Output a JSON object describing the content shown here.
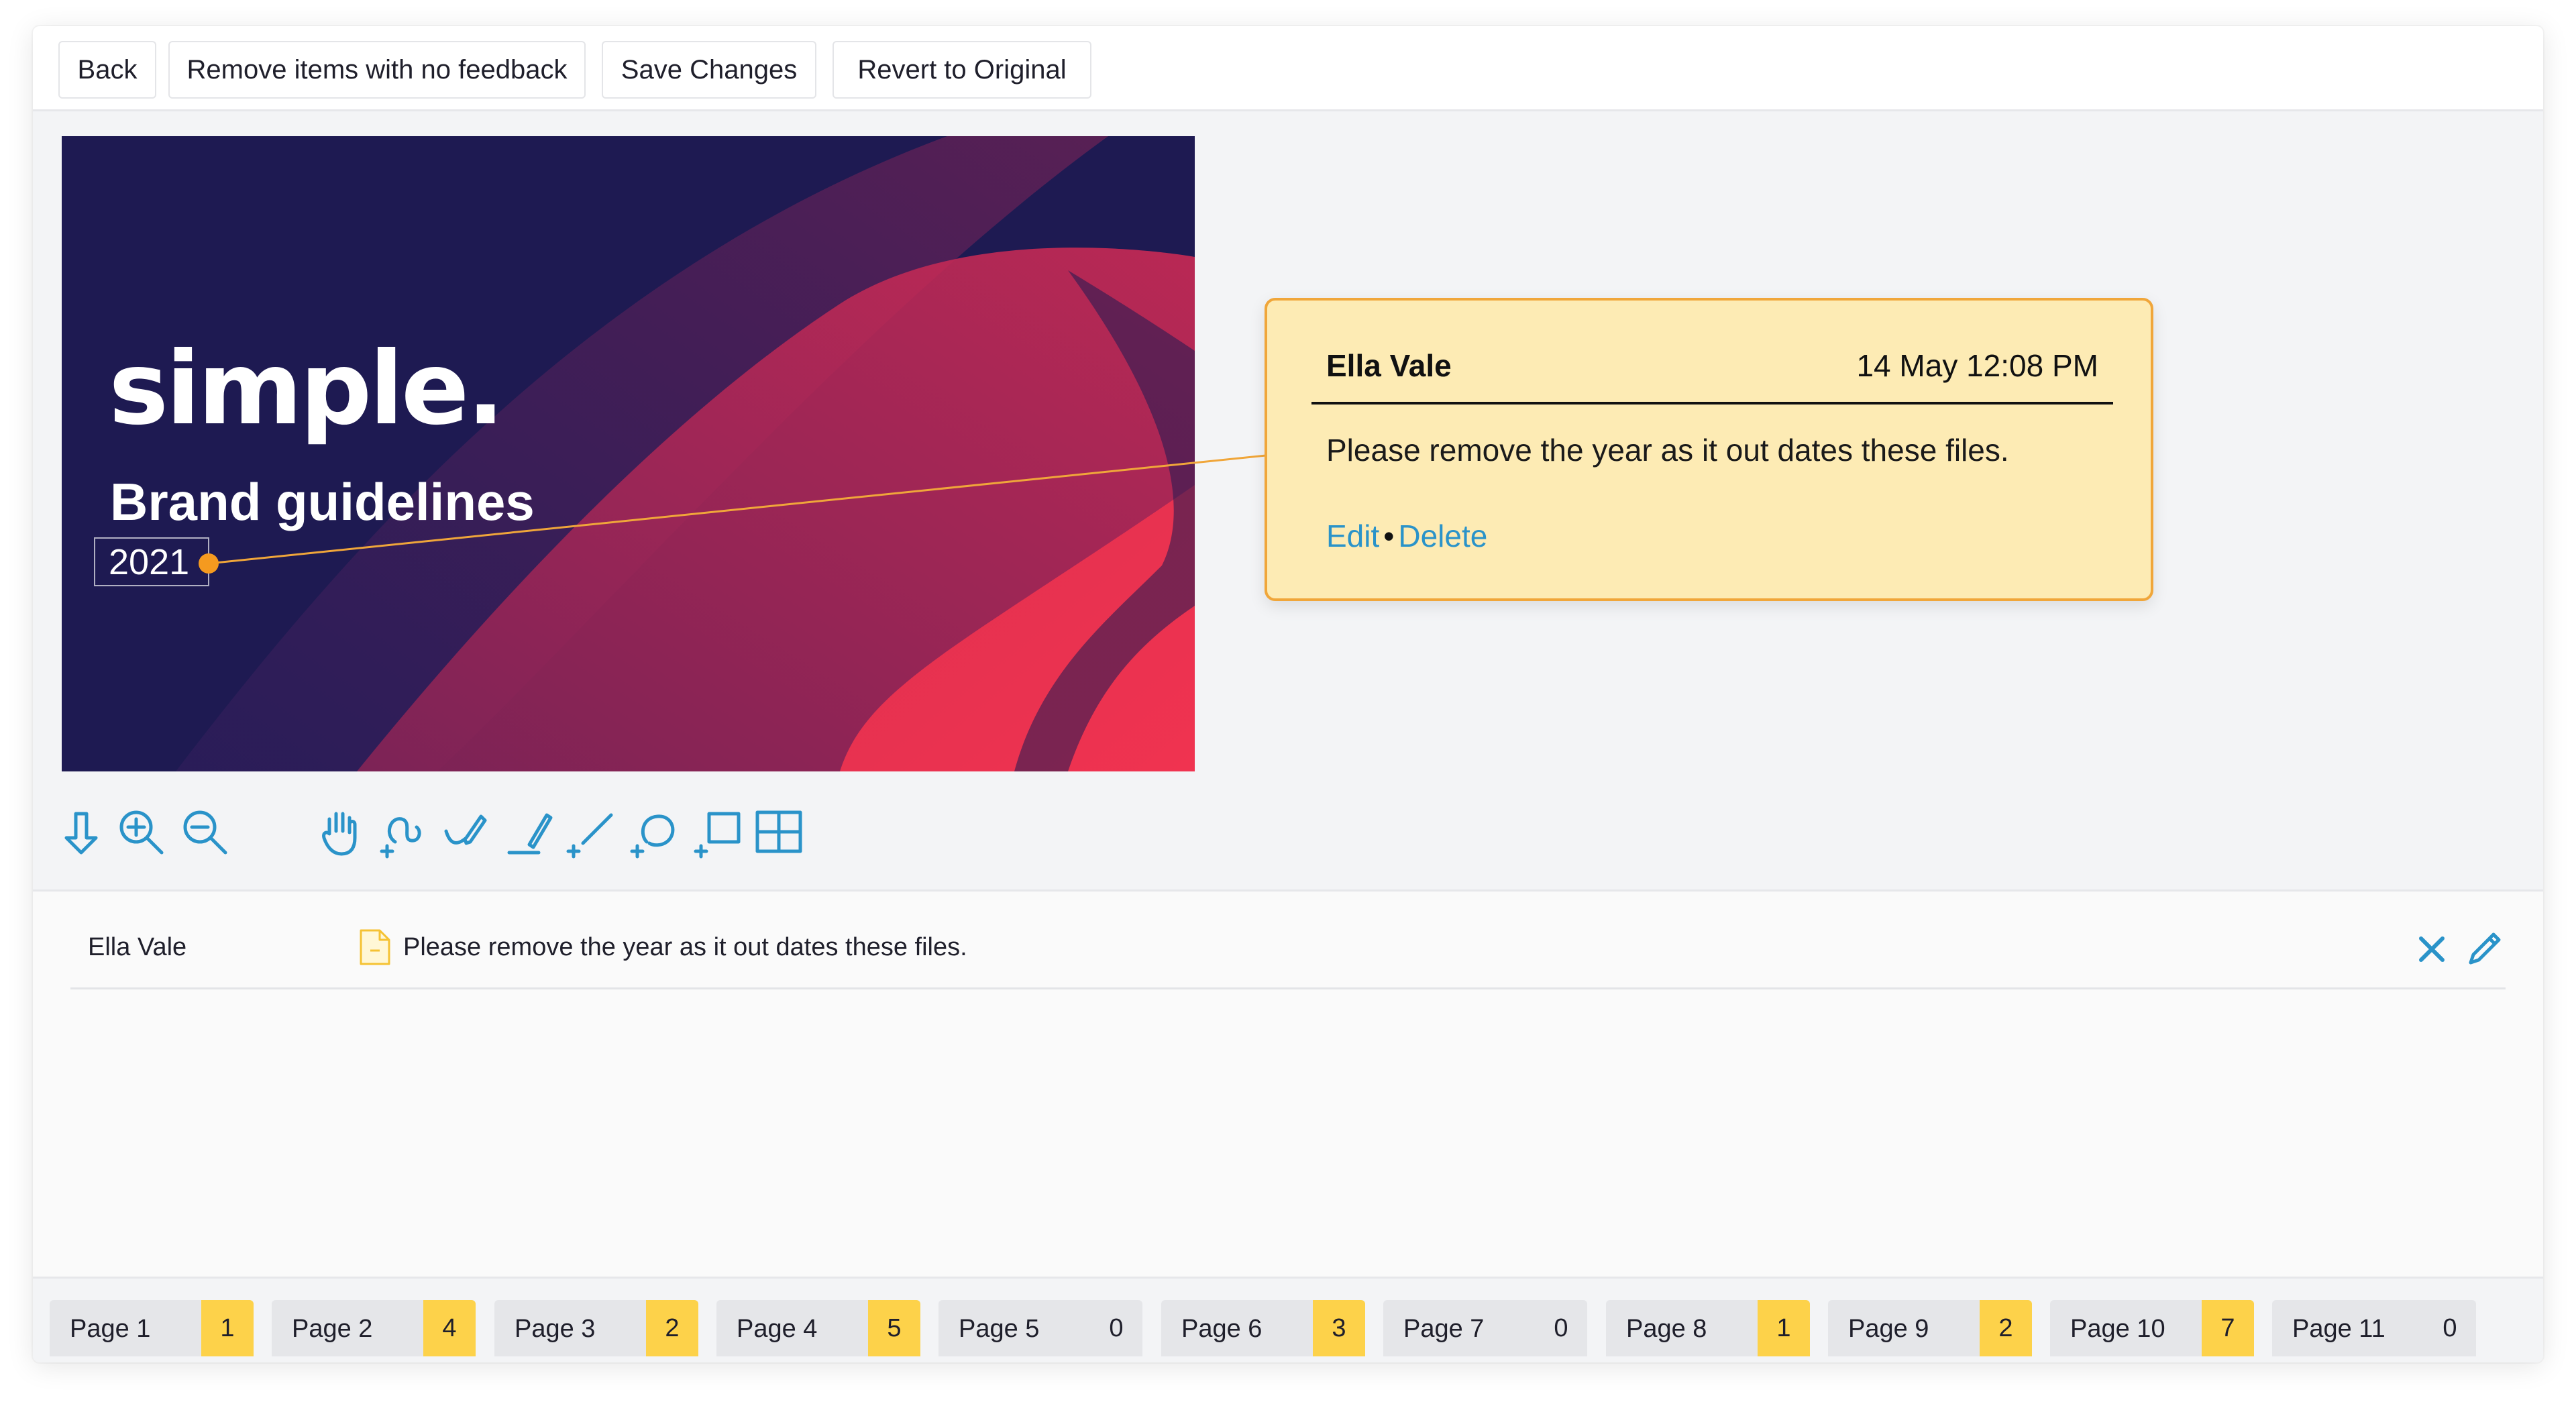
{
  "toolbar": {
    "buttons": [
      {
        "id": "back",
        "label": "Back"
      },
      {
        "id": "remove-no-feedback",
        "label": "Remove items with no feedback"
      },
      {
        "id": "save",
        "label": "Save Changes"
      },
      {
        "id": "revert",
        "label": "Revert to Original"
      }
    ]
  },
  "slide": {
    "logo": "simple.",
    "title": "Brand guidelines",
    "year": "2021",
    "colors": {
      "background": "#1e1a52",
      "accent": "#e8334f"
    }
  },
  "comment": {
    "author": "Ella Vale",
    "time": "14 May 12:08 PM",
    "body": "Please remove the year as it out dates these files.",
    "edit_label": "Edit",
    "separator": "•",
    "delete_label": "Delete",
    "colors": {
      "background": "#fdebb4",
      "border": "#f0a63a",
      "link": "#2a93c9"
    }
  },
  "tools": [
    "download-icon",
    "zoom-in-icon",
    "zoom-out-icon",
    "hand-icon",
    "freehand-icon",
    "pen-icon",
    "highlight-icon",
    "line-icon",
    "lasso-icon",
    "rectangle-icon",
    "grid-icon"
  ],
  "feedback": {
    "items": [
      {
        "author": "Ella Vale",
        "text": "Please remove the year as it out dates these files."
      }
    ]
  },
  "pages": [
    {
      "label": "Page 1",
      "count": "1"
    },
    {
      "label": "Page 2",
      "count": "4"
    },
    {
      "label": "Page 3",
      "count": "2"
    },
    {
      "label": "Page 4",
      "count": "5"
    },
    {
      "label": "Page 5",
      "count": "0"
    },
    {
      "label": "Page 6",
      "count": "3"
    },
    {
      "label": "Page 7",
      "count": "0"
    },
    {
      "label": "Page 8",
      "count": "1"
    },
    {
      "label": "Page 9",
      "count": "2"
    },
    {
      "label": "Page 10",
      "count": "7"
    },
    {
      "label": "Page 11",
      "count": "0"
    }
  ]
}
